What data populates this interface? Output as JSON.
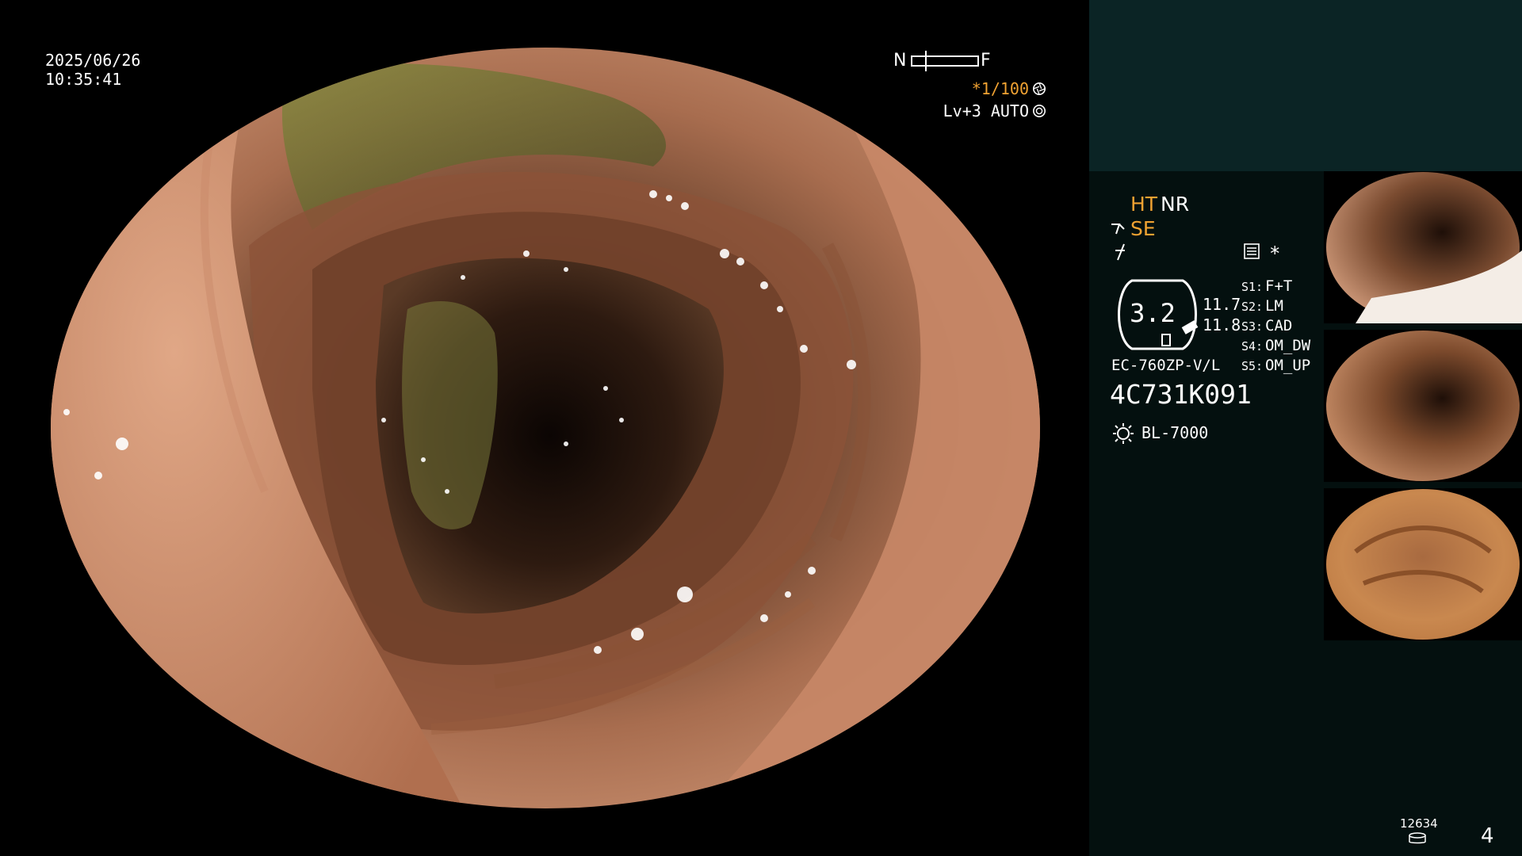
{
  "overlay": {
    "date": "2025/06/26",
    "time": "10:35:41",
    "nf_near": "N",
    "nf_far": "F",
    "shutter": "*1/100",
    "shutter_icon": "aperture-icon",
    "level": "Lv+3 AUTO",
    "level_icon": "iris-icon"
  },
  "panel": {
    "ht": "HT",
    "nr": "NR",
    "se": "SE",
    "se_icon": "tool-icon",
    "mode_icon": "mode-icon",
    "settings_icon": "settings-icon",
    "star": "*",
    "gauge_value": "3.2",
    "value_top": "11.7",
    "value_bottom": "11.8",
    "scope_model": "EC-760ZP-V/L",
    "serial": "4C731K091",
    "light_icon": "light-source-icon",
    "light_model": "BL-7000",
    "s_settings": [
      {
        "key": "S1:",
        "value": "F+T"
      },
      {
        "key": "S2:",
        "value": "LM"
      },
      {
        "key": "S3:",
        "value": "CAD"
      },
      {
        "key": "S4:",
        "value": "OM_DW"
      },
      {
        "key": "S5:",
        "value": "OM_UP"
      }
    ],
    "image_count": "12634",
    "storage_icon": "storage-icon",
    "page_number": "4"
  },
  "colors": {
    "accent_orange": "#f0a232",
    "panel_bg": "#04100f",
    "panel_top_bg": "#0b2425",
    "mucosa": "#b77a5a"
  }
}
